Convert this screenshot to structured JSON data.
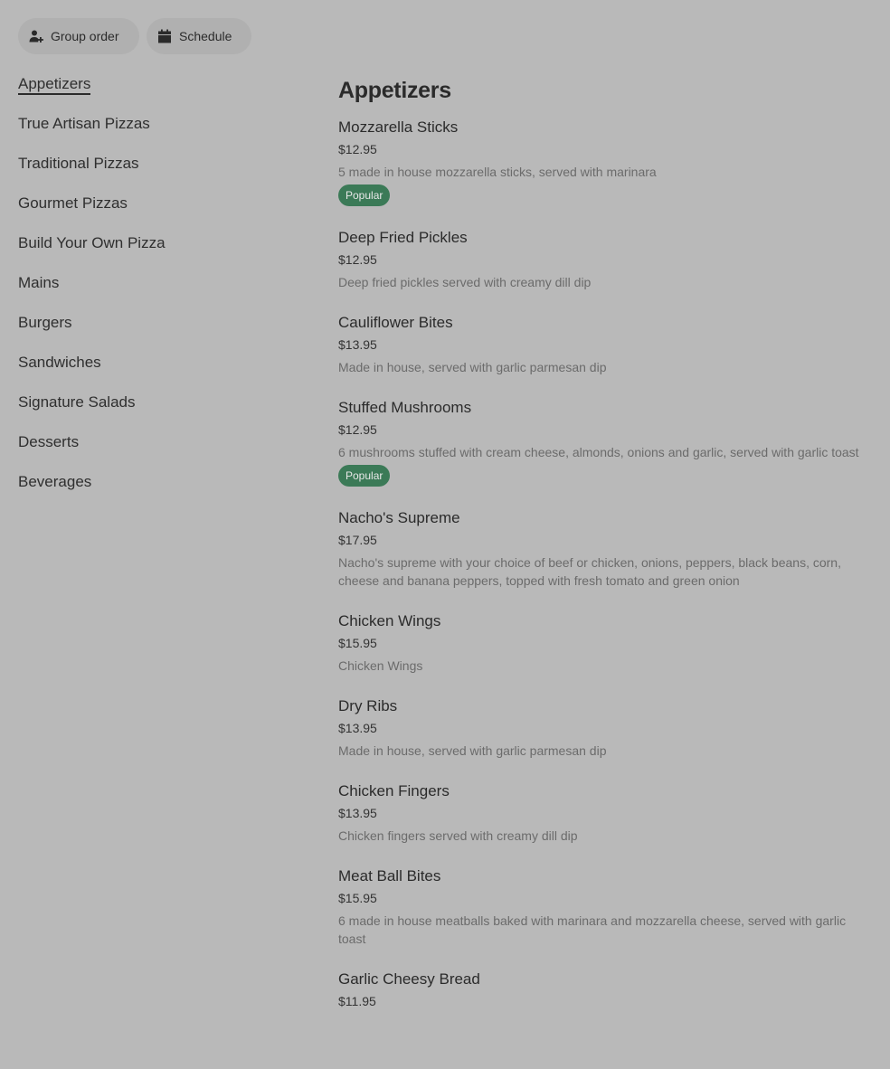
{
  "actions": {
    "group_order": "Group order",
    "schedule": "Schedule"
  },
  "categories": [
    "Appetizers",
    "True Artisan Pizzas",
    "Traditional Pizzas",
    "Gourmet Pizzas",
    "Build Your Own Pizza",
    "Mains",
    "Burgers",
    "Sandwiches",
    "Signature Salads",
    "Desserts",
    "Beverages"
  ],
  "section": {
    "title": "Appetizers",
    "items": [
      {
        "name": "Mozzarella Sticks",
        "price": "$12.95",
        "desc": "5 made in house mozzarella sticks, served with marinara",
        "badge": "Popular"
      },
      {
        "name": "Deep Fried Pickles",
        "price": "$12.95",
        "desc": "Deep fried pickles served with creamy dill dip"
      },
      {
        "name": "Cauliflower Bites",
        "price": "$13.95",
        "desc": "Made in house, served with garlic parmesan dip"
      },
      {
        "name": "Stuffed Mushrooms",
        "price": "$12.95",
        "desc": "6 mushrooms stuffed with cream cheese, almonds, onions and garlic, served with garlic toast",
        "badge": "Popular"
      },
      {
        "name": "Nacho's Supreme",
        "price": "$17.95",
        "desc": "Nacho's supreme with your choice of beef or chicken, onions, peppers, black beans, corn, cheese and banana peppers, topped with fresh tomato and green onion"
      },
      {
        "name": "Chicken Wings",
        "price": "$15.95",
        "desc": "Chicken Wings"
      },
      {
        "name": "Dry Ribs",
        "price": "$13.95",
        "desc": "Made in house, served with garlic parmesan dip"
      },
      {
        "name": "Chicken Fingers",
        "price": "$13.95",
        "desc": "Chicken fingers served with creamy dill dip"
      },
      {
        "name": "Meat Ball Bites",
        "price": "$15.95",
        "desc": "6 made in house meatballs baked with marinara and mozzarella cheese, served with garlic toast"
      },
      {
        "name": "Garlic Cheesy Bread",
        "price": "$11.95",
        "desc": ""
      }
    ]
  },
  "colors": {
    "background": "#b9b9b9",
    "badge": "#3b7a57"
  },
  "icons": {
    "group_order": "person-add-icon",
    "schedule": "calendar-icon"
  }
}
